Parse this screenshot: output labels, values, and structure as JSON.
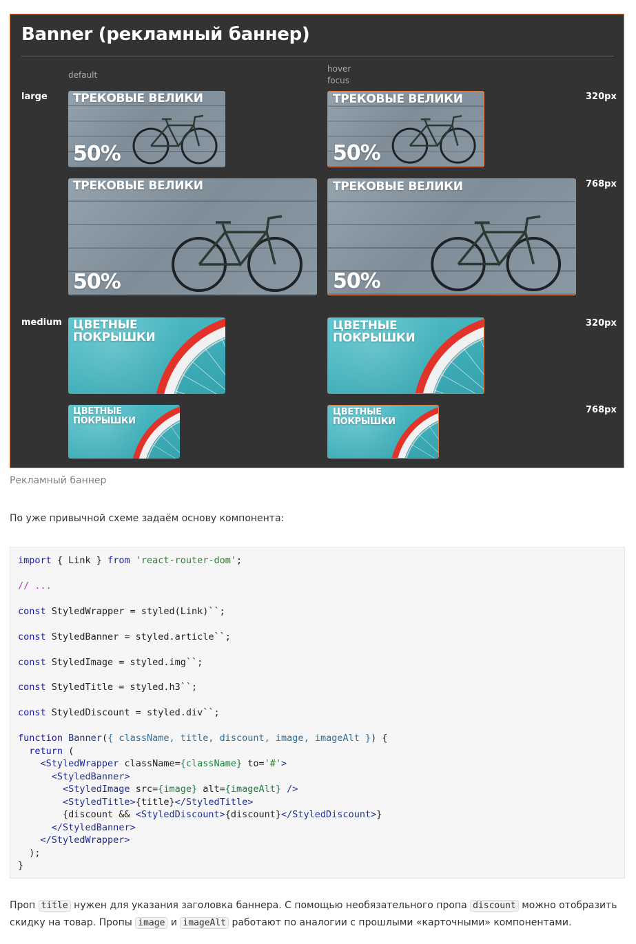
{
  "figure": {
    "title": "Banner (рекламный баннер)",
    "col_default": "default",
    "col_hover": [
      "hover",
      "focus"
    ],
    "rows": {
      "large": "large",
      "medium": "medium"
    },
    "sizes": {
      "s320": "320px",
      "s768": "768px"
    },
    "accent_color": "#d9743f"
  },
  "banners": {
    "bike_title": "ТРЕКОВЫЕ ВЕЛИКИ",
    "bike_discount": "50%",
    "tire_title": "ЦВЕТНЫЕ ПОКРЫШКИ"
  },
  "caption": "Рекламный баннер",
  "intro": "По уже привычной схеме задаём основу компонента:",
  "code": {
    "l1": [
      "import",
      " { Link } ",
      "from",
      " ",
      "'react-router-dom'",
      ";"
    ],
    "l2": "// ...",
    "l3": [
      "const",
      " StyledWrapper = styled(Link)``;"
    ],
    "l4": [
      "const",
      " StyledBanner = styled.article``;"
    ],
    "l5": [
      "const",
      " StyledImage = styled.img``;"
    ],
    "l6": [
      "const",
      " StyledTitle = styled.h3``;"
    ],
    "l7": [
      "const",
      " StyledDiscount = styled.div``;"
    ],
    "l8": [
      "function",
      " ",
      "Banner",
      "(",
      "{ className, title, discount, image, imageAlt }",
      ") {"
    ],
    "l9": [
      "  ",
      "return",
      " ("
    ],
    "l10": [
      "    ",
      "<StyledWrapper",
      " className=",
      "{className}",
      " to=",
      "'#'",
      ">"
    ],
    "l11": [
      "      ",
      "<StyledBanner>"
    ],
    "l12": [
      "        ",
      "<StyledImage",
      " src=",
      "{image}",
      " alt=",
      "{imageAlt}",
      " />"
    ],
    "l13": [
      "        ",
      "<StyledTitle>",
      "{title}",
      "</StyledTitle>"
    ],
    "l14": [
      "        ",
      "{discount && ",
      "<StyledDiscount>",
      "{discount}",
      "</StyledDiscount>",
      "}"
    ],
    "l15": [
      "      ",
      "</StyledBanner>"
    ],
    "l16": [
      "    ",
      "</StyledWrapper>"
    ],
    "l17": "  );",
    "l18": "}"
  },
  "outro": {
    "t1": "Проп ",
    "c1": "title",
    "t2": " нужен для указания заголовка баннера. С помощью необязательного пропа ",
    "c2": "discount",
    "t3": " можно отобразить",
    "t4": "скидку на товар. Пропы ",
    "c3": "image",
    "t5": " и ",
    "c4": "imageAlt",
    "t6": " работают по аналогии с прошлыми «карточными» компонентами."
  }
}
